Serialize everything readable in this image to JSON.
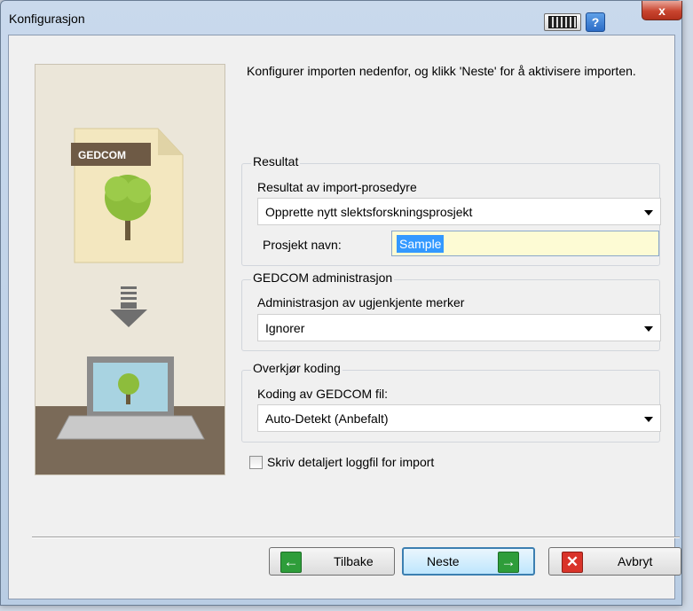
{
  "window": {
    "title": "Konfigurasjon",
    "help_label": "?",
    "close_label": "x"
  },
  "illustration": {
    "badge": "GEDCOM"
  },
  "intro_text": "Konfigurer importen nedenfor, og klikk 'Neste' for å aktivisere importen.",
  "result_group": {
    "title": "Resultat",
    "procedure_label": "Resultat av import-prosedyre",
    "procedure_value": "Opprette nytt slektsforskningsprosjekt",
    "project_name_label": "Prosjekt navn:",
    "project_name_value": "Sample"
  },
  "gedcom_group": {
    "title": "GEDCOM administrasjon",
    "tags_label": "Administrasjon av ugjenkjente merker",
    "tags_value": "Ignorer"
  },
  "encoding_group": {
    "title": "Overkjør koding",
    "encoding_label": "Koding av GEDCOM fil:",
    "encoding_value": "Auto-Detekt (Anbefalt)"
  },
  "log_checkbox": {
    "label": "Skriv detaljert loggfil for import",
    "checked": false
  },
  "buttons": {
    "back": "Tilbake",
    "next": "Neste",
    "cancel": "Avbryt"
  },
  "colors": {
    "accent_green": "#2e9d3a",
    "cancel_red": "#d9342a",
    "selection_blue": "#3399ff",
    "textbox_fill": "#fdfbd4"
  }
}
